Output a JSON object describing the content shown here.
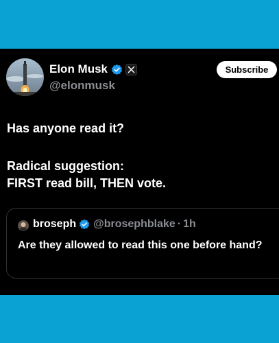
{
  "tweet": {
    "author_name": "Elon Musk",
    "author_handle": "@elonmusk",
    "subscribe_label": "Subscribe",
    "line1": "Has anyone read it?",
    "line2": "Radical suggestion:",
    "line3": "FIRST read bill, THEN vote."
  },
  "quote": {
    "author_name": "broseph",
    "author_handle": "@brosephblake",
    "separator": "·",
    "time": "1h",
    "text": "Are they allowed to read this one before hand?"
  },
  "colors": {
    "background_frame": "#0aa1d3",
    "card": "#000000",
    "verified": "#1d9bf0",
    "muted_text": "#8a8d91"
  },
  "icons": {
    "verified": "verified-badge-icon",
    "affiliate": "x-logo-icon"
  }
}
